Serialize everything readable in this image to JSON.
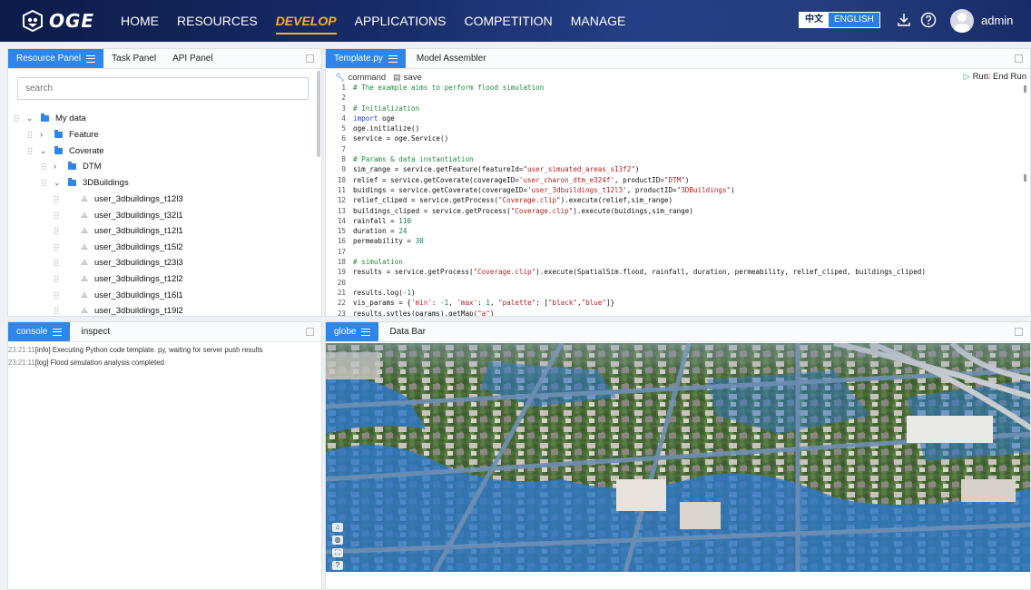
{
  "header": {
    "logo_text": "OGE",
    "nav": [
      {
        "label": "HOME"
      },
      {
        "label": "RESOURCES"
      },
      {
        "label": "DEVELOP"
      },
      {
        "label": "APPLICATIONS"
      },
      {
        "label": "COMPETITION"
      },
      {
        "label": "MANAGE"
      }
    ],
    "lang_zh": "中文",
    "lang_en": "ENGLISH",
    "username": "admin",
    "active_color": "#ffb020"
  },
  "resource_panel": {
    "tabs": [
      {
        "label": "Resource Panel"
      },
      {
        "label": "Task Panel"
      },
      {
        "label": "API Panel"
      }
    ],
    "search_placeholder": "search",
    "tree": [
      {
        "label": "My data"
      },
      {
        "label": "Feature"
      },
      {
        "label": "Coverate"
      },
      {
        "label": "DTM"
      },
      {
        "label": "3DBuildings"
      },
      {
        "label": "user_3dbuildings_t12l3"
      },
      {
        "label": "user_3dbuildings_t32l1"
      },
      {
        "label": "user_3dbuildings_t12l1"
      },
      {
        "label": "user_3dbuildings_t15l2"
      },
      {
        "label": "user_3dbuildings_t23l3"
      },
      {
        "label": "user_3dbuildings_t12l2"
      },
      {
        "label": "user_3dbuildings_t16l1"
      },
      {
        "label": "user_3dbuildings_t19l2"
      }
    ]
  },
  "editor": {
    "tabs": [
      {
        "label": "Template.py"
      },
      {
        "label": "Model Assembler"
      }
    ],
    "command_label": "command",
    "save_label": "save",
    "run_label": "Run",
    "end_run_label": "End Run"
  },
  "console": {
    "tabs": [
      {
        "label": "console"
      },
      {
        "label": "inspect"
      }
    ],
    "lines": [
      {
        "time": "23:21:11",
        "text": "[info] Executing Python code template. py, waiting for server push results"
      },
      {
        "time": "23:21:11",
        "text": "[log] Flood simulation analysis completed"
      }
    ]
  },
  "globe": {
    "tabs": [
      {
        "label": "globe"
      },
      {
        "label": "Data Bar"
      }
    ]
  }
}
